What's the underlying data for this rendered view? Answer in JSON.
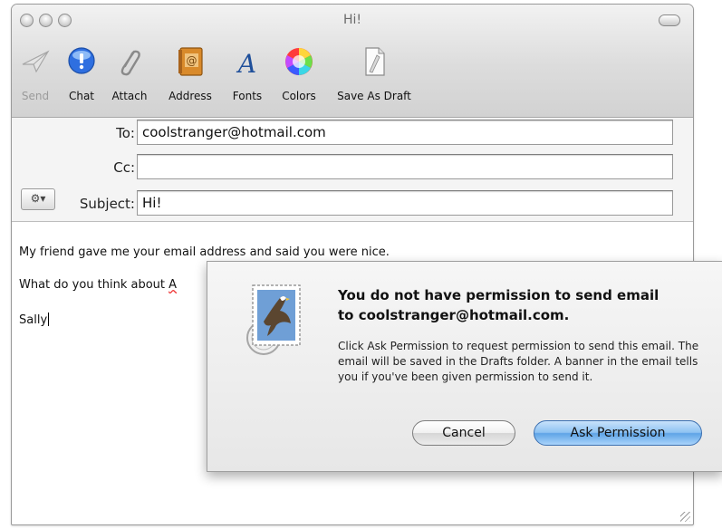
{
  "window": {
    "title": "Hi!"
  },
  "toolbar": {
    "items": [
      {
        "label": "Send",
        "icon": "send-icon",
        "enabled": false
      },
      {
        "label": "Chat",
        "icon": "chat-icon",
        "enabled": true
      },
      {
        "label": "Attach",
        "icon": "paperclip-icon",
        "enabled": true
      },
      {
        "label": "Address",
        "icon": "address-book-icon",
        "enabled": true
      },
      {
        "label": "Fonts",
        "icon": "fonts-icon",
        "enabled": true
      },
      {
        "label": "Colors",
        "icon": "color-wheel-icon",
        "enabled": true
      },
      {
        "label": "Save As Draft",
        "icon": "save-draft-icon",
        "enabled": true
      }
    ]
  },
  "header": {
    "to_label": "To:",
    "to_value": "coolstranger@hotmail.com",
    "cc_label": "Cc:",
    "cc_value": "",
    "subject_label": "Subject:",
    "subject_value": "Hi!",
    "action_menu": "gear-icon"
  },
  "message": {
    "line1": "My friend gave me your email address and said you were nice.",
    "line2_start": "What do you think about ",
    "line2_misspelled": "A",
    "line3": "Sally"
  },
  "sheet": {
    "icon": "mail-stamp-eagle-icon",
    "title_line1": "You do not have permission to send email",
    "title_line2": "to coolstranger@hotmail.com.",
    "message": "Click Ask Permission to request permission to send this email. The email will be saved in the Drafts folder. A banner in the email tells you if you've been given permission to send it.",
    "cancel_label": "Cancel",
    "ask_label": "Ask Permission"
  },
  "colors": {
    "default_button": "#5ea4e6",
    "chat_icon": "#2f6fe0",
    "address_book": "#d98a2b"
  }
}
